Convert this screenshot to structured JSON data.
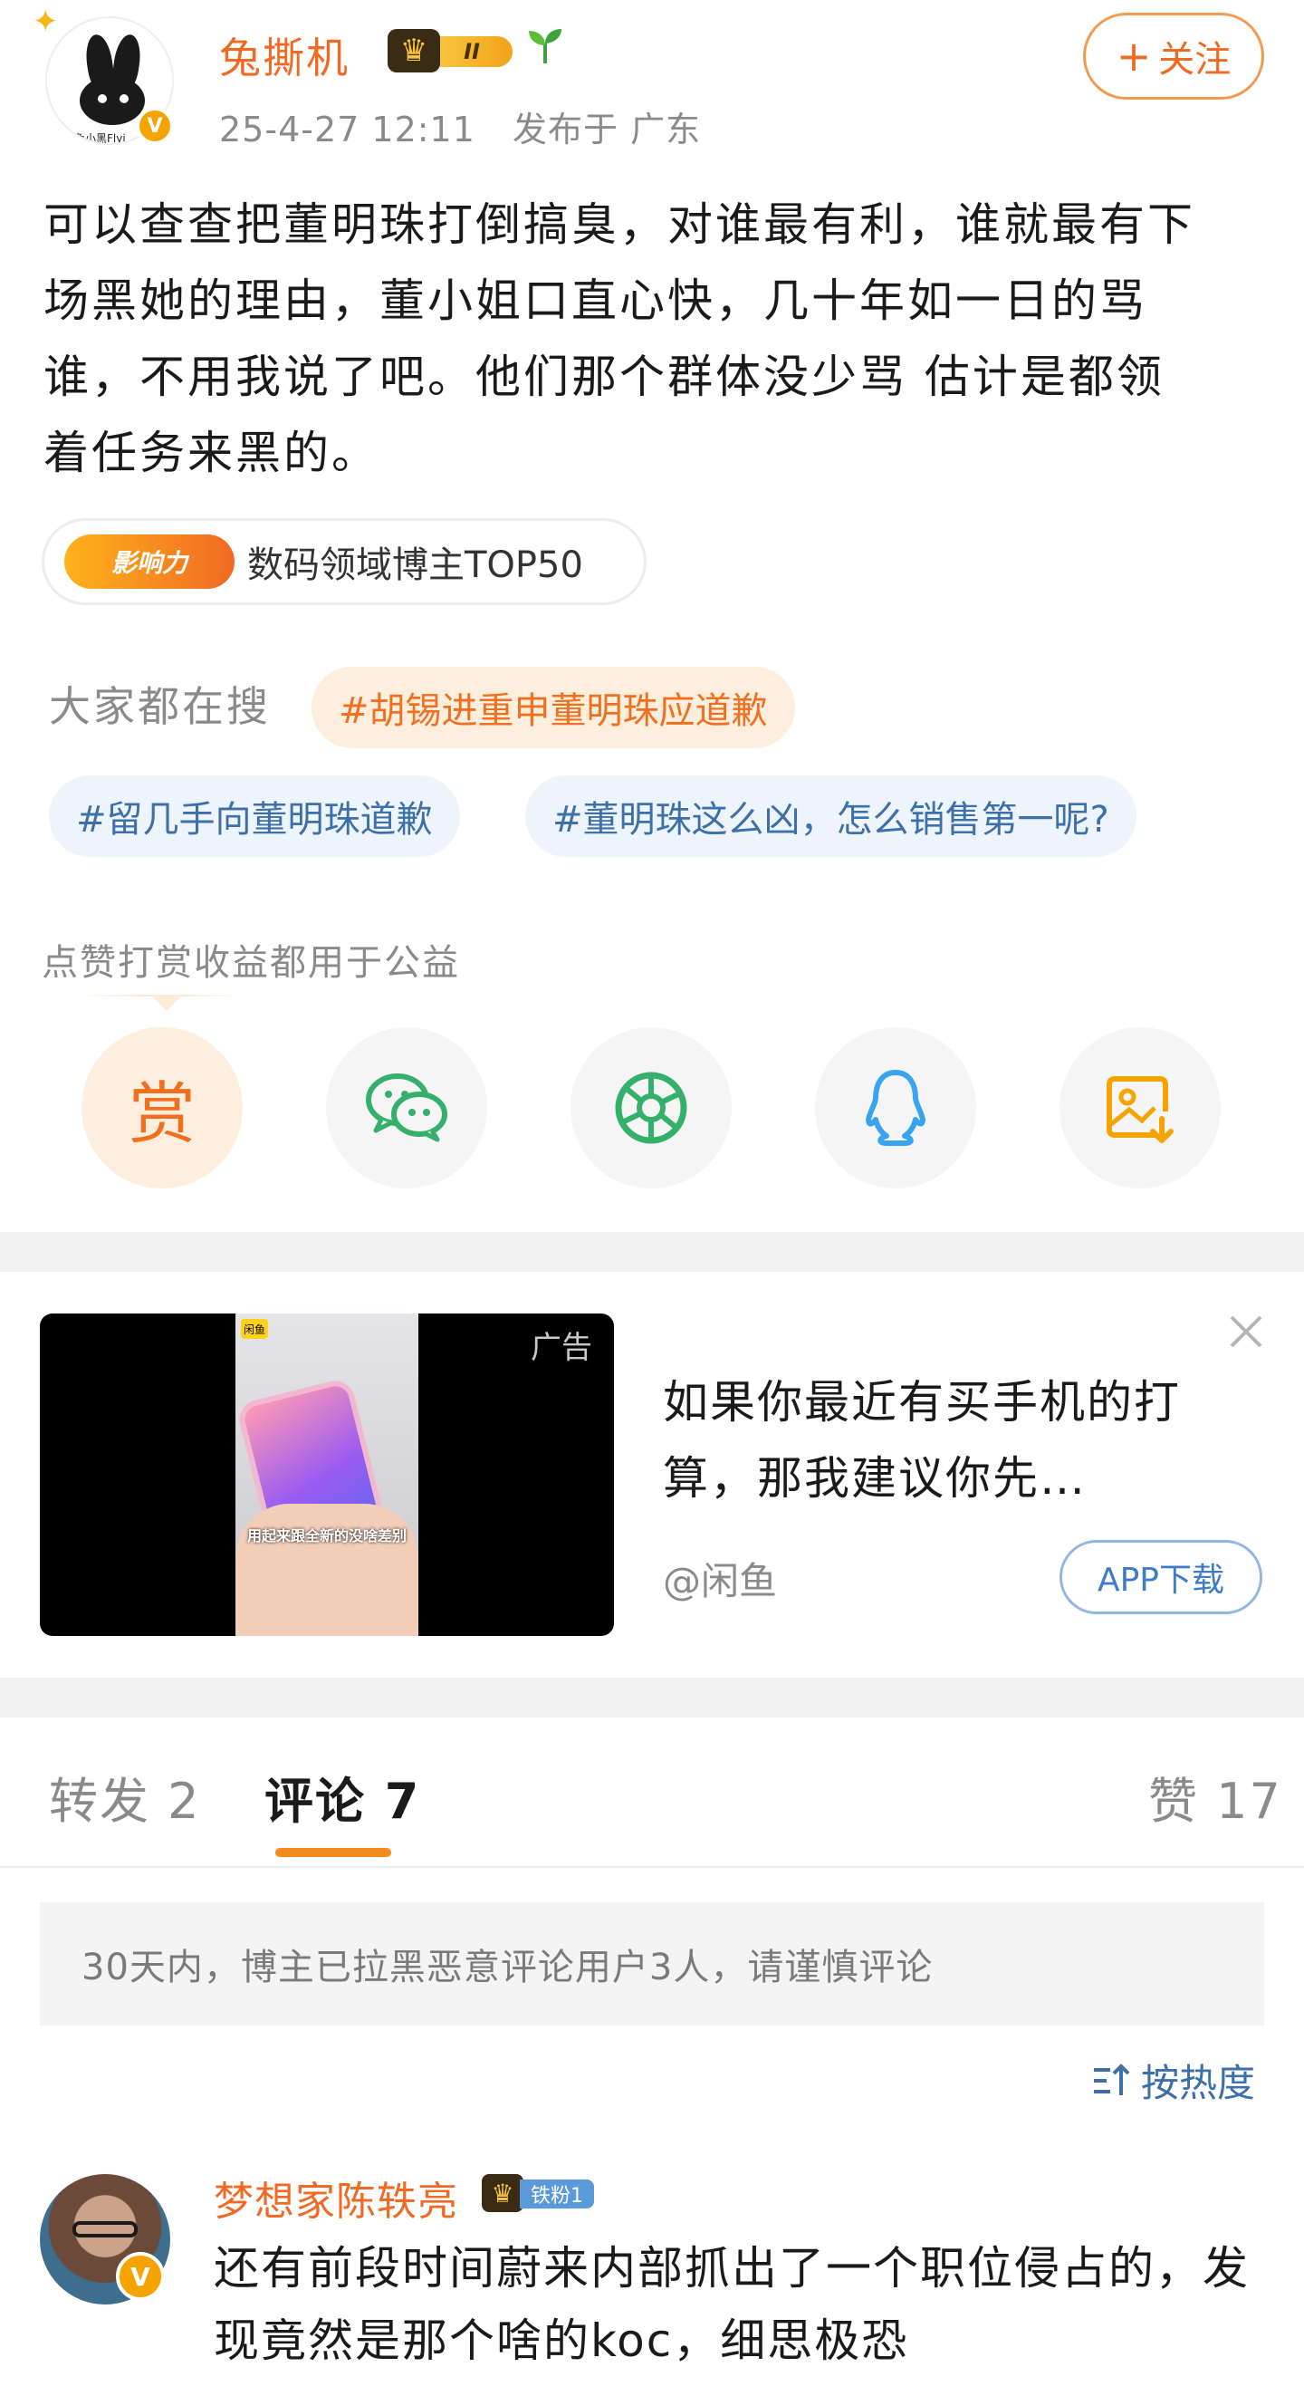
{
  "post": {
    "author": "兔撕机",
    "avatar_caption": "兔小黑Flyi",
    "level_badge": "II",
    "timestamp": "25-4-27 12:11",
    "location": "发布于 广东",
    "follow_label": "关注",
    "text_lines": [
      "可以查查把董明珠打倒搞臭，对谁最有利，谁就最有下",
      "场黑她的理由，董小姐口直心快，几十年如一日的骂",
      "谁，不用我说了吧。他们那个群体没少骂  估计是都领",
      "着任务来黑的。"
    ],
    "influence_badge": "影响力",
    "influence_text": "数码领域博主TOP50"
  },
  "search": {
    "label": "大家都在搜",
    "tags": [
      "#胡锡进重申董明珠应道歉",
      "#留几手向董明珠道歉",
      "#董明珠这么凶，怎么销售第一呢?"
    ]
  },
  "charity_note": "点赞打赏收益都用于公益",
  "share": {
    "reward_glyph": "赏",
    "icons": [
      "reward-icon",
      "wechat-icon",
      "moments-icon",
      "qq-icon",
      "save-image-icon"
    ]
  },
  "ad": {
    "label": "广告",
    "brand": "闲鱼",
    "video_caption": "用起来跟全新的没啥差别",
    "title": "如果你最近有买手机的打算，那我建议你先…",
    "source": "@闲鱼",
    "download_label": "APP下载"
  },
  "tabs": {
    "repost": "转发 2",
    "comments": "评论 7",
    "likes": "赞 17"
  },
  "notice": "30天内，博主已拉黑恶意评论用户3人，请谨慎评论",
  "sort_label": "按热度",
  "comment": {
    "author": "梦想家陈轶亮",
    "fan_badge": "铁粉1",
    "text": "还有前段时间蔚来内部抓出了一个职位侵占的，发现竟然是那个啥的koc，细思极恐"
  },
  "colors": {
    "accent_orange": "#f06a24",
    "link_blue": "#3d6fa8",
    "muted_gray": "#8a8a8a"
  }
}
